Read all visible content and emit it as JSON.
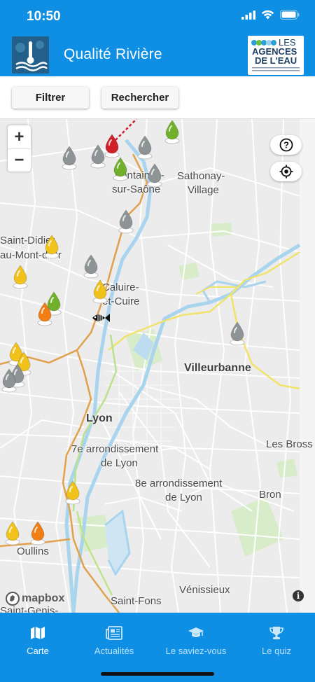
{
  "status": {
    "time": "10:50"
  },
  "header": {
    "title": "Qualité Rivière",
    "partner_logo": {
      "line1": "LES",
      "line2": "AGENCES",
      "line3": "DE L'EAU"
    }
  },
  "toolbar": {
    "filter_label": "Filtrer",
    "search_label": "Rechercher"
  },
  "map": {
    "zoom_in": "+",
    "zoom_out": "−",
    "help_icon": "?",
    "info_icon": "i",
    "attribution": "mapbox",
    "labels": {
      "fontaines": "Fontaines-",
      "sur_saone": "sur-Saône",
      "sathonay": "Sathonay-",
      "village": "Village",
      "saint_didier": "Saint-Didier",
      "au_mont": "au-Mont-d'Or",
      "caluire": "Caluire-",
      "et_cuire": "et-Cuire",
      "villeurbanne": "Villeurbanne",
      "lyon": "Lyon",
      "arr7_a": "7e arrondissement",
      "arr7_b": "de Lyon",
      "arr8_a": "8e arrondissement",
      "arr8_b": "de Lyon",
      "les_bross": "Les Bross",
      "bron": "Bron",
      "oullins": "Oullins",
      "venissieux": "Vénissieux",
      "saint_fons": "Saint-Fons",
      "saint_genis": "Saint-Genis-"
    },
    "pin_colors": {
      "grey": "#8e9396",
      "yellow": "#f1c21b",
      "green": "#71b02b",
      "orange": "#f07e14",
      "red": "#d0202c"
    }
  },
  "tabs": [
    {
      "label": "Carte",
      "icon": "map-icon",
      "active": true
    },
    {
      "label": "Actualités",
      "icon": "newspaper-icon",
      "active": false
    },
    {
      "label": "Le saviez-vous",
      "icon": "graduation-cap-icon",
      "active": false
    },
    {
      "label": "Le quiz",
      "icon": "trophy-icon",
      "active": false
    }
  ]
}
